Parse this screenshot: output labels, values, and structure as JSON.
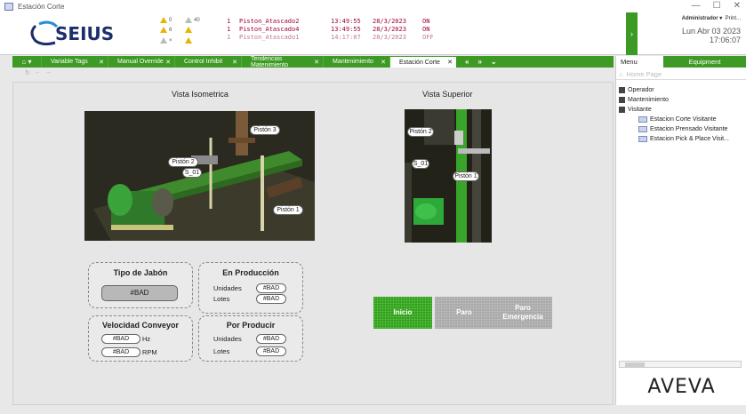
{
  "window": {
    "title": "Estación Corte",
    "controls": [
      "—",
      "☐",
      "✕"
    ]
  },
  "logo_text": "SEIUS",
  "alarm_summary": [
    {
      "count": "6",
      "extra": "0"
    },
    {
      "count": "6",
      "extra": "40"
    },
    {
      "count": "6",
      "extra": ""
    },
    {
      "count": "",
      "extra": ""
    }
  ],
  "alarms": [
    {
      "priority": "1",
      "name": "Piston_Atascado2",
      "time": "13:49:55",
      "date": "28/3/2023",
      "state": "ON"
    },
    {
      "priority": "1",
      "name": "Piston_Atascado4",
      "time": "13:49:55",
      "date": "28/3/2023",
      "state": "ON"
    },
    {
      "priority": "1",
      "name": "Piston_Atascado1",
      "time": "14:17:07",
      "date": "28/3/2023",
      "state": "OFF"
    }
  ],
  "user": {
    "name": "Administrador ▾",
    "print": "Print...",
    "date": "Lun Abr 03 2023",
    "time": "17:06:07"
  },
  "tabs": [
    {
      "label": "Variable Tags",
      "active": false
    },
    {
      "label": "Manual Override",
      "active": false
    },
    {
      "label": "Control Inhibit",
      "active": false
    },
    {
      "label": "Tendencias Matenimiento",
      "active": false
    },
    {
      "label": "Mantenimiento",
      "active": false
    },
    {
      "label": "Estación Corte",
      "active": true
    }
  ],
  "nav_arrows": [
    "«",
    "»",
    "⌄"
  ],
  "main": {
    "iso_title": "Vista Isometrica",
    "top_title": "Vista Superior",
    "iso_labels": {
      "piston3": "Pistón 3",
      "piston2": "Pistón 2",
      "s01": "S_01",
      "piston1": "Pistón 1"
    },
    "top_labels": {
      "piston2": "Pistón 2",
      "s01": "S_01",
      "piston1": "Pistón 1"
    },
    "tipo_jabon": {
      "title": "Tipo de Jabón",
      "value": "#BAD"
    },
    "en_produccion": {
      "title": "En Producción",
      "units_label": "Unidades",
      "units_value": "#BAD",
      "lots_label": "Lotes",
      "lots_value": "#BAD"
    },
    "velocidad": {
      "title": "Velocidad Conveyor",
      "hz_value": "#BAD",
      "hz_unit": "Hz",
      "rpm_value": "#BAD",
      "rpm_unit": "RPM"
    },
    "por_producir": {
      "title": "Por Producir",
      "units_label": "Unidades",
      "units_value": "#BAD",
      "lots_label": "Lotes",
      "lots_value": "#BAD"
    },
    "buttons": {
      "start": "Inicio",
      "stop": "Paro",
      "emergency_line1": "Paro",
      "emergency_line2": "Emergencia"
    }
  },
  "right_panel": {
    "tab_menu": "Menu",
    "tab_equipment": "Equipment",
    "home": "Home Page",
    "tree": [
      "Operador",
      "Mantenimiento",
      "Visitante"
    ],
    "visitor_items": [
      "Estacion Corte Visitante",
      "Estacion Prensado Visitante",
      "Estacion Pick & Place Visit..."
    ],
    "brand": "AVEVA"
  },
  "colors": {
    "accent_green": "#3d9a24",
    "alarm_text": "#a0003a"
  }
}
